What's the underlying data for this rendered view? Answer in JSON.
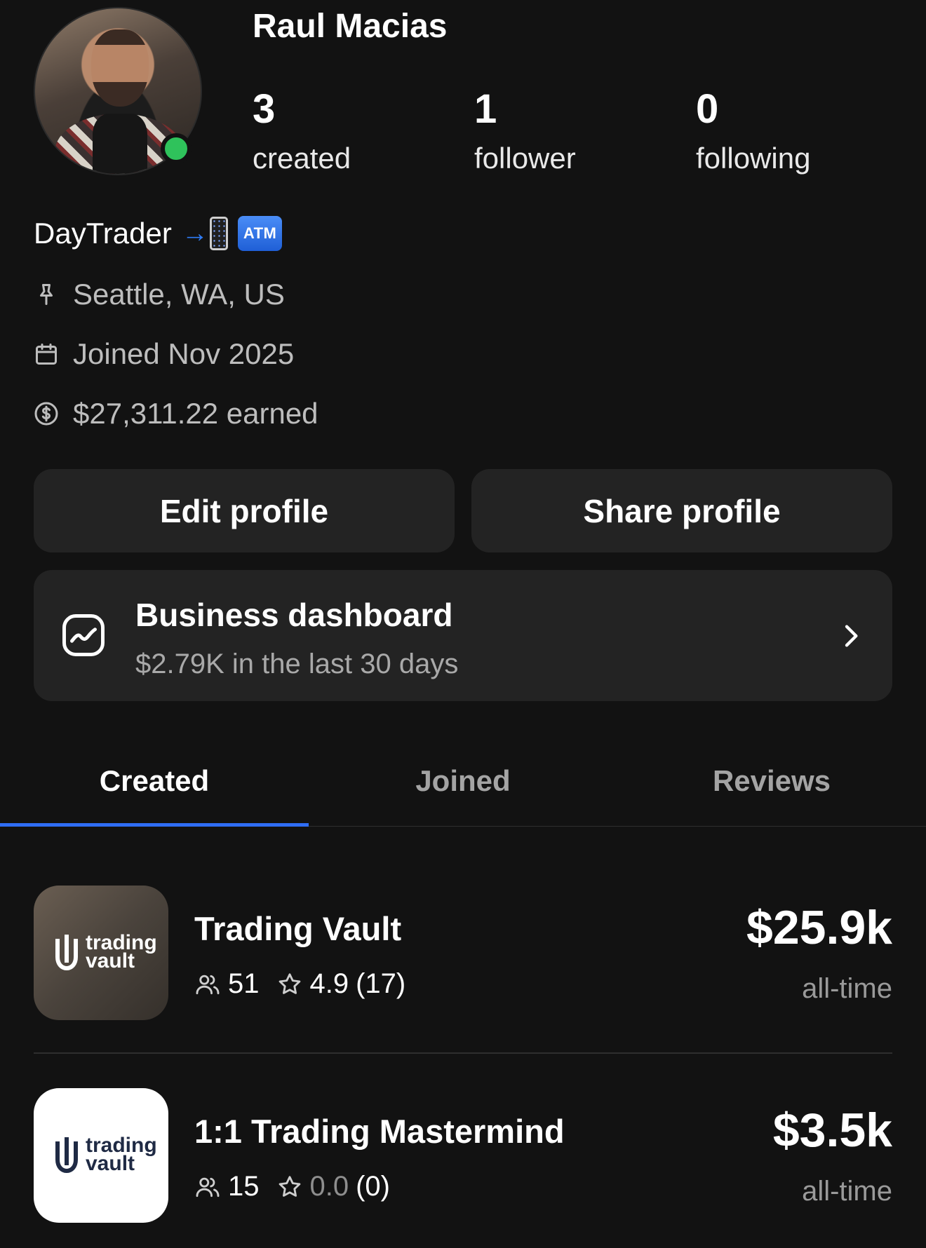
{
  "profile": {
    "name": "Raul Macias",
    "online": true,
    "stats": [
      {
        "value": "3",
        "label": "created"
      },
      {
        "value": "1",
        "label": "follower"
      },
      {
        "value": "0",
        "label": "following"
      }
    ],
    "bio_text": "DayTrader",
    "bio_emojis": [
      "mobile-phone-arrow-emoji",
      "atm-sign-emoji"
    ],
    "atm_label": "ATM",
    "location": "Seattle, WA, US",
    "joined": "Joined Nov 2025",
    "earned": "$27,311.22 earned"
  },
  "actions": {
    "edit": "Edit profile",
    "share": "Share profile"
  },
  "dashboard": {
    "title": "Business dashboard",
    "subtitle": "$2.79K in the last 30 days"
  },
  "tabs": [
    {
      "label": "Created",
      "active": true
    },
    {
      "label": "Joined",
      "active": false
    },
    {
      "label": "Reviews",
      "active": false
    }
  ],
  "items": [
    {
      "title": "Trading Vault",
      "members": "51",
      "rating": "4.9",
      "reviews": "(17)",
      "price": "$25.9k",
      "period": "all-time",
      "logo_word_1": "trading",
      "logo_word_2": "vault"
    },
    {
      "title": "1:1 Trading Mastermind",
      "members": "15",
      "rating": "0.0",
      "reviews": "(0)",
      "price": "$3.5k",
      "period": "all-time",
      "logo_word_1": "trading",
      "logo_word_2": "vault"
    }
  ],
  "colors": {
    "background": "#121212",
    "card": "#232323",
    "accent": "#2f6df5",
    "online": "#2fc25b"
  }
}
